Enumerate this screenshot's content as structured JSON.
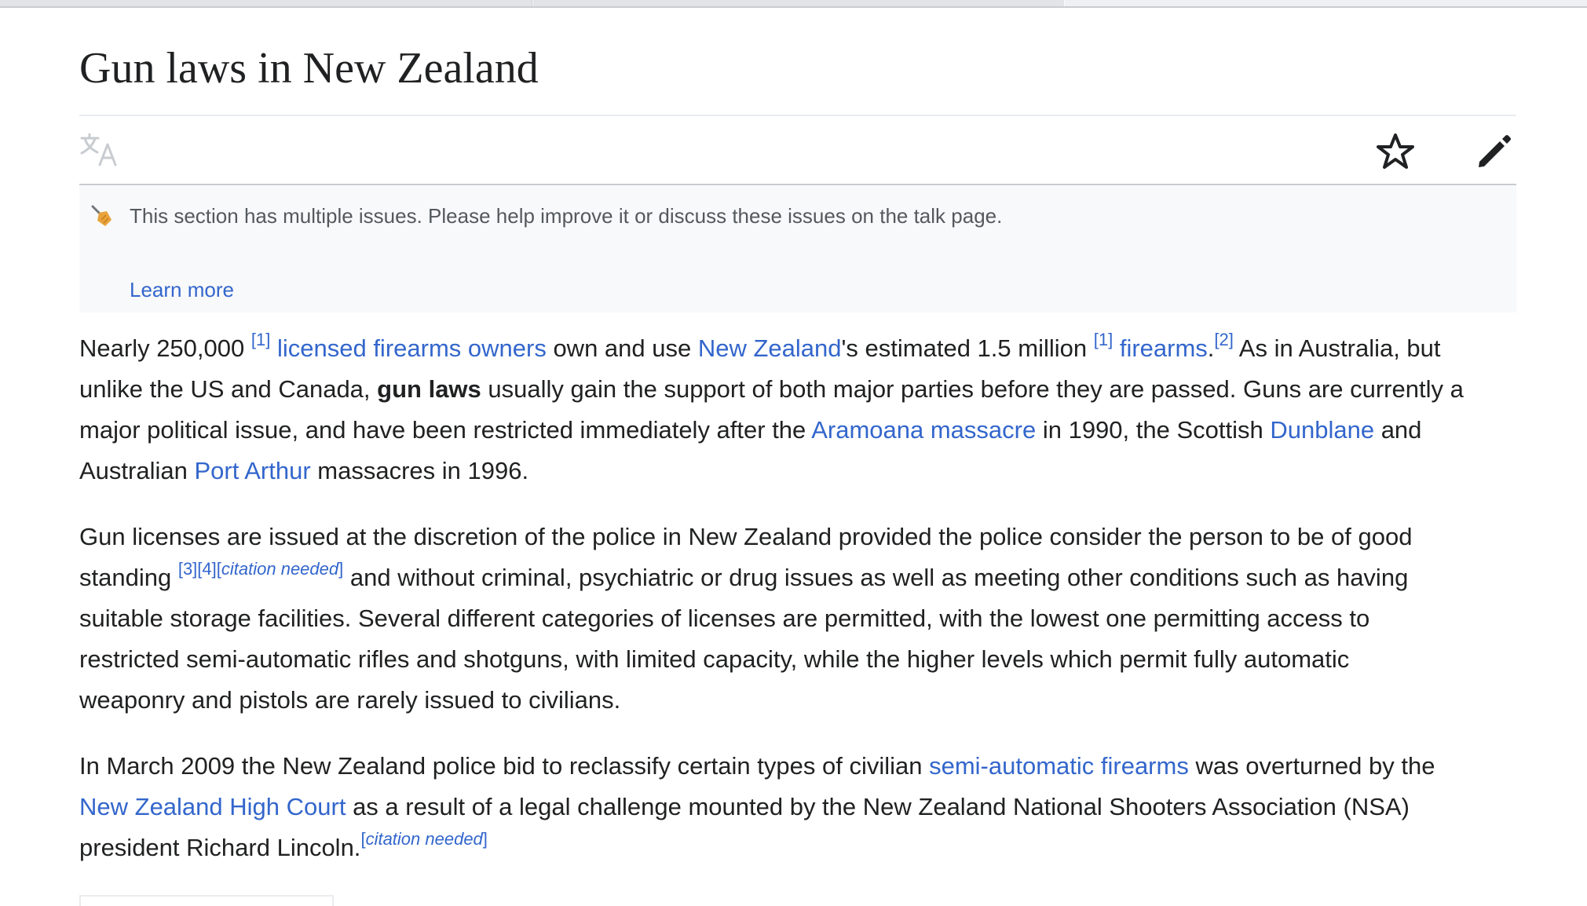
{
  "page": {
    "title": "Gun laws in New Zealand"
  },
  "notice": {
    "text": "This section has multiple issues. Please help improve it or discuss these issues on the talk page.",
    "learn_more": "Learn more"
  },
  "icons": {
    "language": "translate-icon",
    "watch": "star-icon",
    "edit": "pencil-icon",
    "notice": "broom-icon",
    "notice_color": "#e8a33d"
  },
  "colors": {
    "link": "#3366cc",
    "text": "#202122",
    "notice_bg": "#f8f9fa"
  },
  "p1": {
    "t1": "Nearly 250,000 ",
    "ref1": "[1]",
    "link1": "licensed firearms owners",
    "t2": " own and use ",
    "link2": "New Zealand",
    "t3": "'s estimated 1.5 million ",
    "ref2": "[1]",
    "link3": "firearms",
    "t4": ".",
    "ref3": "[2]",
    "t5": " As in Australia, but",
    "t6": "unlike the US and Canada, ",
    "bold1": "gun laws",
    "t7": " usually gain the support of both major parties before they are passed. Guns are currently a",
    "t8": "major political issue, and have been restricted immediately after the ",
    "link4": "Aramoana massacre",
    "t9": " in 1990, the Scottish ",
    "link5": "Dunblane",
    "t10": " and",
    "t11": "Australian ",
    "link6": "Port Arthur",
    "t12": " massacres in 1996."
  },
  "p2": {
    "t1": "Gun licenses are issued at the discretion of the police in New Zealand provided the police consider the person to be of good",
    "t2": "standing ",
    "ref1": "[3]",
    "ref2": "[4]",
    "cn_open": "[",
    "cn": "citation needed",
    "cn_close": "]",
    "t3": " and without criminal, psychiatric or drug issues as well as meeting other conditions such as having",
    "t4": "suitable storage facilities. Several different categories of licenses are permitted, with the lowest one permitting access to",
    "t5": "restricted semi-automatic rifles and shotguns, with limited capacity, while the higher levels which permit fully automatic",
    "t6": "weaponry and pistols are rarely issued to civilians."
  },
  "p3": {
    "t1": "In March 2009 the New Zealand police bid to reclassify certain types of civilian ",
    "link1": "semi-automatic firearms",
    "t2": " was overturned by the",
    "link2": "New Zealand High Court",
    "t3": " as a result of a legal challenge mounted by the New Zealand National Shooters Association (NSA)",
    "t4": "president Richard Lincoln.",
    "cn_open": "[",
    "cn": "citation needed",
    "cn_close": "]"
  }
}
